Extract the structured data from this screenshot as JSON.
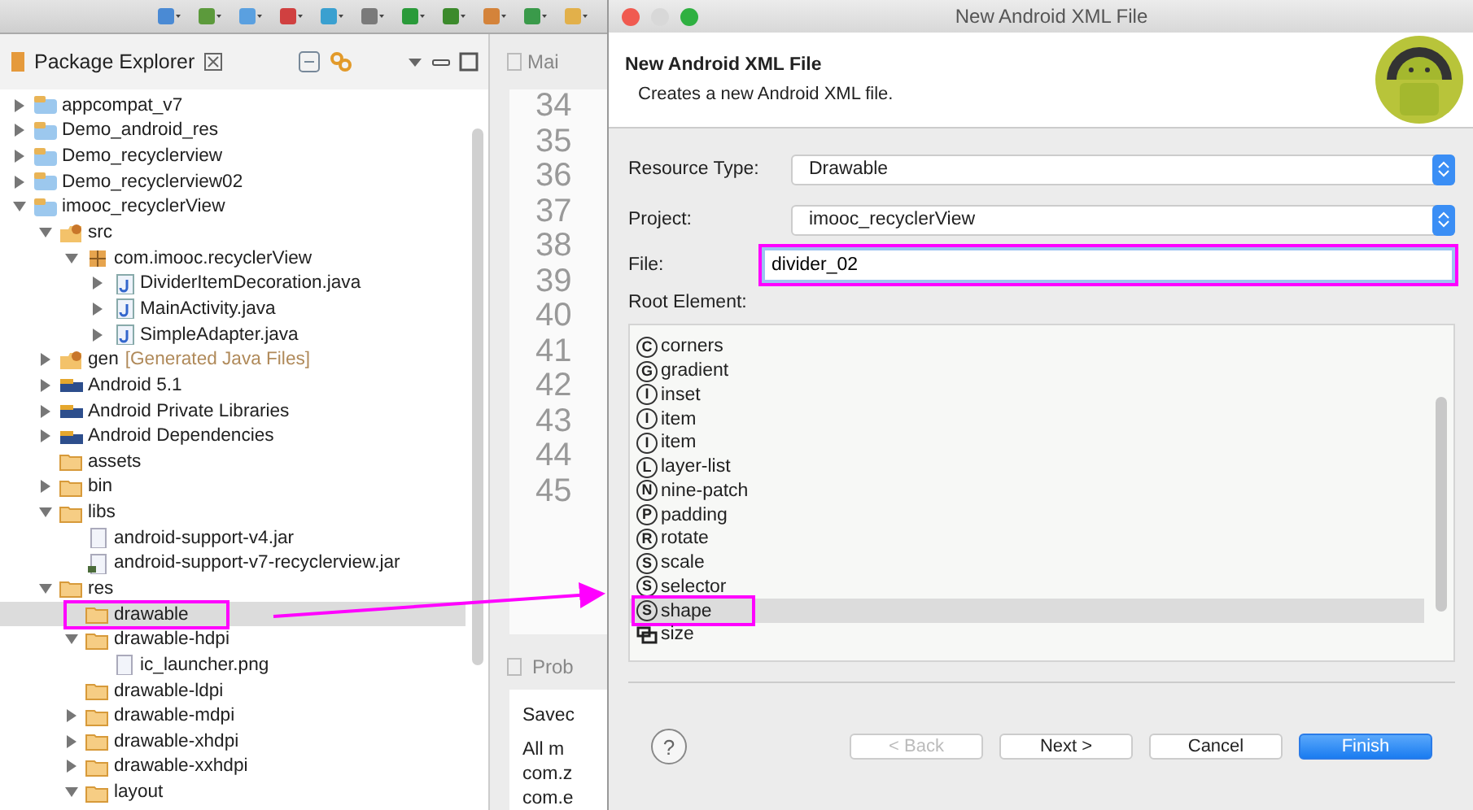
{
  "explorer": {
    "title": "Package Explorer",
    "tree": [
      {
        "label": "appcompat_v7",
        "kind": "project",
        "expanded": false,
        "selected": false,
        "highlighted": false
      },
      {
        "label": "Demo_android_res",
        "kind": "project",
        "expanded": false,
        "selected": false,
        "highlighted": false
      },
      {
        "label": "Demo_recyclerview",
        "kind": "project",
        "expanded": false,
        "selected": false,
        "highlighted": false
      },
      {
        "label": "Demo_recyclerview02",
        "kind": "project",
        "expanded": false,
        "selected": false,
        "highlighted": false
      },
      {
        "label": "imooc_recyclerView",
        "kind": "project",
        "expanded": true,
        "selected": false,
        "highlighted": false,
        "children": [
          {
            "label": "src",
            "kind": "srcfolder",
            "expanded": true,
            "selected": false,
            "highlighted": false,
            "children": [
              {
                "label": "com.imooc.recyclerView",
                "kind": "package",
                "expanded": true,
                "selected": false,
                "highlighted": false,
                "children": [
                  {
                    "label": "DividerItemDecoration.java",
                    "kind": "java",
                    "expanded": false,
                    "selected": false,
                    "highlighted": false
                  },
                  {
                    "label": "MainActivity.java",
                    "kind": "java",
                    "expanded": false,
                    "selected": false,
                    "highlighted": false
                  },
                  {
                    "label": "SimpleAdapter.java",
                    "kind": "java",
                    "expanded": false,
                    "selected": false,
                    "highlighted": false
                  }
                ]
              }
            ]
          },
          {
            "label": "gen",
            "note": "[Generated Java Files]",
            "kind": "srcfolder",
            "expanded": false,
            "selected": false,
            "highlighted": false
          },
          {
            "label": "Android 5.1",
            "kind": "library",
            "expanded": false,
            "selected": false,
            "highlighted": false
          },
          {
            "label": "Android Private Libraries",
            "kind": "library",
            "expanded": false,
            "selected": false,
            "highlighted": false
          },
          {
            "label": "Android Dependencies",
            "kind": "library",
            "expanded": false,
            "selected": false,
            "highlighted": false
          },
          {
            "label": "assets",
            "kind": "folder",
            "selected": false,
            "highlighted": false
          },
          {
            "label": "bin",
            "kind": "folder",
            "expanded": false,
            "selected": false,
            "highlighted": false
          },
          {
            "label": "libs",
            "kind": "folder",
            "expanded": true,
            "selected": false,
            "highlighted": false,
            "children": [
              {
                "label": "android-support-v4.jar",
                "kind": "file",
                "selected": false,
                "highlighted": false
              },
              {
                "label": "android-support-v7-recyclerview.jar",
                "kind": "jar",
                "selected": false,
                "highlighted": false
              }
            ]
          },
          {
            "label": "res",
            "kind": "folder",
            "expanded": true,
            "selected": false,
            "highlighted": false,
            "children": [
              {
                "label": "drawable",
                "kind": "openfolder",
                "selected": true,
                "highlighted": true
              },
              {
                "label": "drawable-hdpi",
                "kind": "openfolder",
                "expanded": true,
                "selected": false,
                "highlighted": false,
                "children": [
                  {
                    "label": "ic_launcher.png",
                    "kind": "file",
                    "selected": false,
                    "highlighted": false
                  }
                ]
              },
              {
                "label": "drawable-ldpi",
                "kind": "openfolder",
                "selected": false,
                "highlighted": false
              },
              {
                "label": "drawable-mdpi",
                "kind": "openfolder",
                "expanded": false,
                "selected": false,
                "highlighted": false
              },
              {
                "label": "drawable-xhdpi",
                "kind": "openfolder",
                "expanded": false,
                "selected": false,
                "highlighted": false
              },
              {
                "label": "drawable-xxhdpi",
                "kind": "openfolder",
                "expanded": false,
                "selected": false,
                "highlighted": false
              },
              {
                "label": "layout",
                "kind": "openfolder",
                "expanded": true,
                "selected": false,
                "highlighted": false
              }
            ]
          }
        ]
      }
    ]
  },
  "editor": {
    "tab": "Mai",
    "line_numbers": [
      "34",
      "35",
      "36",
      "37",
      "38",
      "39",
      "40",
      "41",
      "42",
      "43",
      "44",
      "45"
    ]
  },
  "problems": {
    "tab": "Prob",
    "lines": [
      "Savec",
      "All m",
      "com.z",
      "com.e"
    ]
  },
  "dialog": {
    "title": "New Android XML File",
    "heading": "New Android XML File",
    "subtitle": "Creates a new Android XML file.",
    "resource_type": {
      "label": "Resource Type:",
      "value": "Drawable"
    },
    "project": {
      "label": "Project:",
      "value": "imooc_recyclerView"
    },
    "file": {
      "label": "File:",
      "value": "divider_02",
      "highlighted": true
    },
    "root_element": {
      "label": "Root Element:",
      "items": [
        {
          "letter": "C",
          "name": "corners",
          "kind": "element",
          "selected": false,
          "highlighted": false
        },
        {
          "letter": "G",
          "name": "gradient",
          "kind": "element",
          "selected": false,
          "highlighted": false
        },
        {
          "letter": "I",
          "name": "inset",
          "kind": "element",
          "selected": false,
          "highlighted": false
        },
        {
          "letter": "I",
          "name": "item",
          "kind": "element",
          "selected": false,
          "highlighted": false
        },
        {
          "letter": "I",
          "name": "item",
          "kind": "element",
          "selected": false,
          "highlighted": false
        },
        {
          "letter": "L",
          "name": "layer-list",
          "kind": "element",
          "selected": false,
          "highlighted": false
        },
        {
          "letter": "N",
          "name": "nine-patch",
          "kind": "element",
          "selected": false,
          "highlighted": false
        },
        {
          "letter": "P",
          "name": "padding",
          "kind": "element",
          "selected": false,
          "highlighted": false
        },
        {
          "letter": "R",
          "name": "rotate",
          "kind": "element",
          "selected": false,
          "highlighted": false
        },
        {
          "letter": "S",
          "name": "scale",
          "kind": "element",
          "selected": false,
          "highlighted": false
        },
        {
          "letter": "S",
          "name": "selector",
          "kind": "element",
          "selected": false,
          "highlighted": false
        },
        {
          "letter": "S",
          "name": "shape",
          "kind": "element",
          "selected": true,
          "highlighted": true
        },
        {
          "name": "size",
          "kind": "size",
          "selected": false,
          "highlighted": false
        }
      ]
    },
    "help": "?",
    "buttons": [
      {
        "label": "< Back",
        "disabled": true,
        "primary": false
      },
      {
        "label": "Next >",
        "disabled": false,
        "primary": false
      },
      {
        "label": "Cancel",
        "disabled": false,
        "primary": false
      },
      {
        "label": "Finish",
        "disabled": false,
        "primary": true
      }
    ]
  },
  "annotation_arrow": {
    "shown": true
  }
}
